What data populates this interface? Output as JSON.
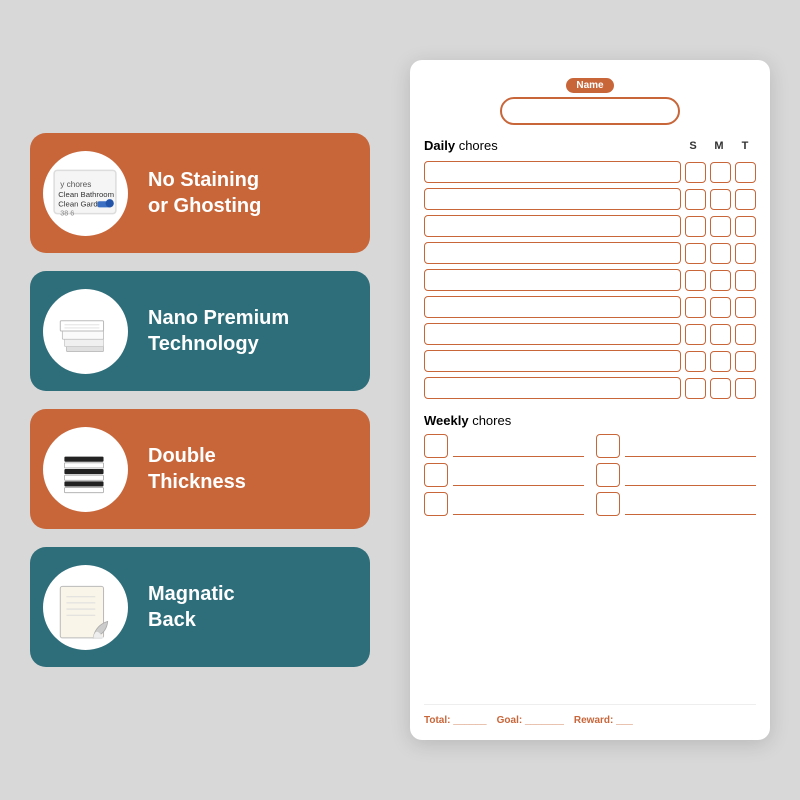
{
  "background": {
    "color": "#d8d8d8"
  },
  "features": [
    {
      "id": "feature-1",
      "color": "orange",
      "icon": "whiteboard",
      "title": "No Staining\nor Ghosting"
    },
    {
      "id": "feature-2",
      "color": "teal",
      "icon": "stacked-papers",
      "title": "Nano Premium\nTechnology"
    },
    {
      "id": "feature-3",
      "color": "orange",
      "icon": "stacked-black",
      "title": "Double\nThickness"
    },
    {
      "id": "feature-4",
      "color": "teal",
      "icon": "magnet",
      "title": "Magnatic\nBack"
    }
  ],
  "chart": {
    "name_label": "Name",
    "daily_title_bold": "Daily",
    "daily_title_light": " chores",
    "day_headers": [
      "S",
      "M",
      "T"
    ],
    "daily_rows": 9,
    "weekly_title_bold": "Weekly",
    "weekly_title_light": " chores",
    "weekly_rows": 3,
    "footer": {
      "total_label": "Total: ______",
      "goal_label": "Goal: _______",
      "reward_label": "Reward: ___"
    }
  }
}
